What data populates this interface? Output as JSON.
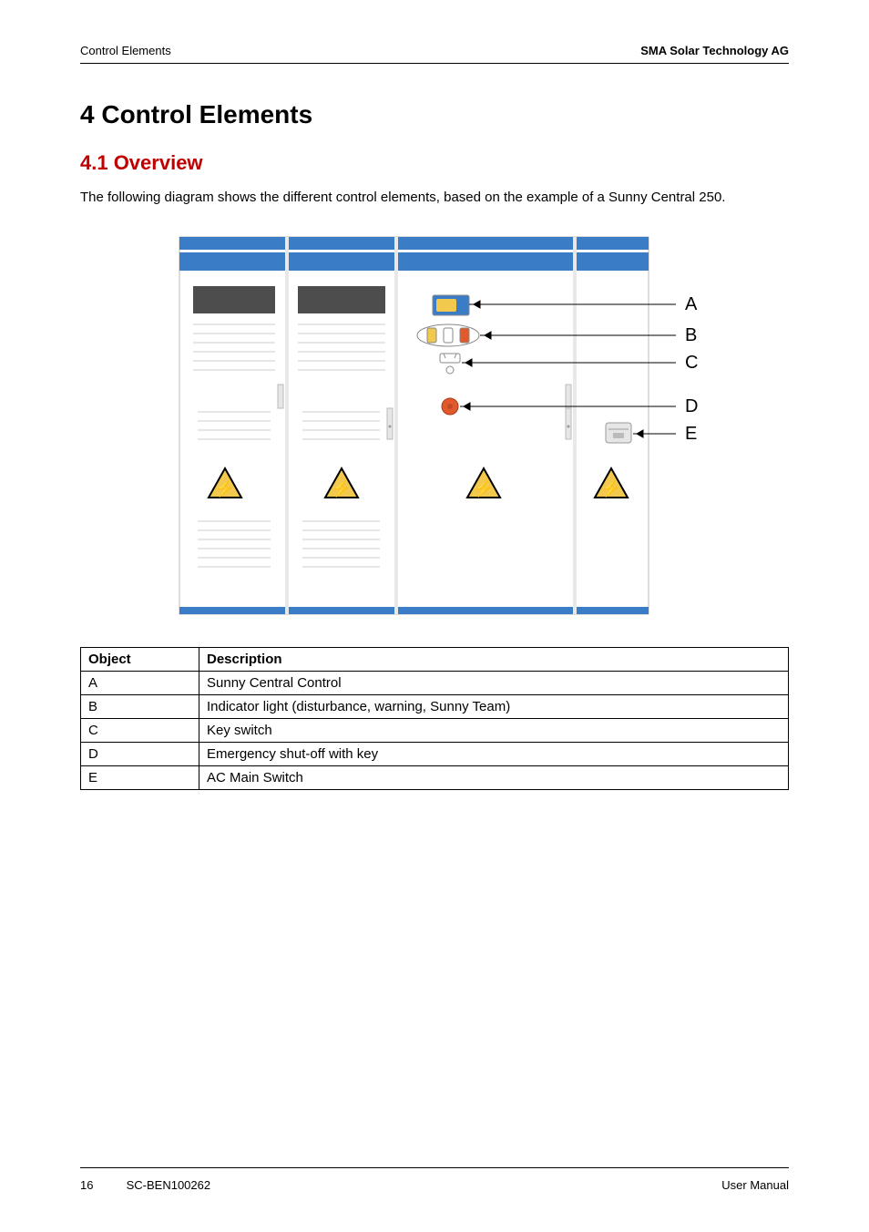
{
  "header": {
    "left": "Control Elements",
    "right": "SMA Solar Technology AG"
  },
  "headings": {
    "h1": "4 Control Elements",
    "h2": "4.1 Overview"
  },
  "intro": "The following diagram shows the different control elements, based on the example of a Sunny Central 250.",
  "diagram": {
    "labels": {
      "A": "A",
      "B": "B",
      "C": "C",
      "D": "D",
      "E": "E"
    }
  },
  "table": {
    "headers": {
      "object": "Object",
      "description": "Description"
    },
    "rows": [
      {
        "object": "A",
        "description": "Sunny Central Control"
      },
      {
        "object": "B",
        "description": "Indicator light (disturbance, warning, Sunny Team)"
      },
      {
        "object": "C",
        "description": "Key switch"
      },
      {
        "object": "D",
        "description": "Emergency shut-off with key"
      },
      {
        "object": "E",
        "description": "AC Main Switch"
      }
    ]
  },
  "footer": {
    "page": "16",
    "doc": "SC-BEN100262",
    "label": "User Manual"
  }
}
